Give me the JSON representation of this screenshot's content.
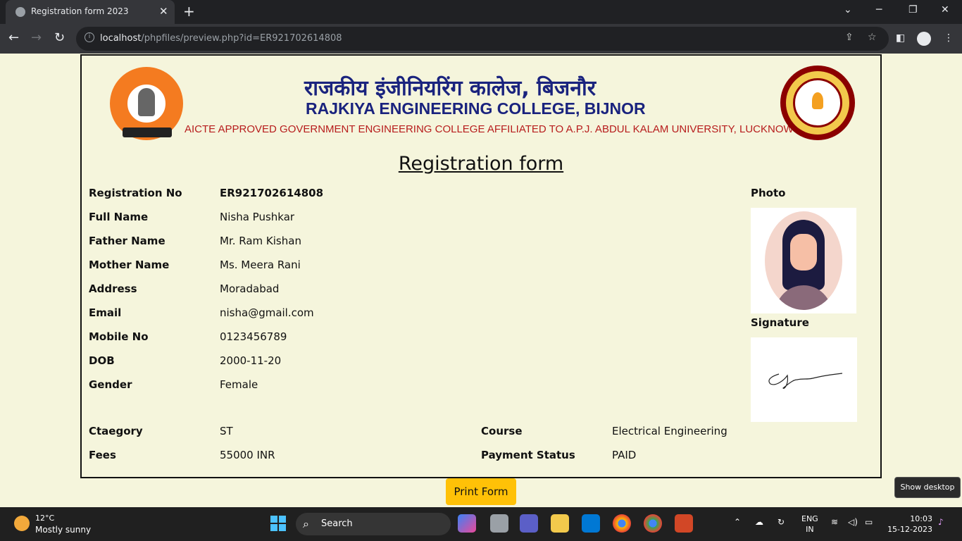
{
  "browser": {
    "tab_title": "Registration form 2023",
    "url_host": "localhost",
    "url_path": "/phpfiles/preview.php?id=ER921702614808"
  },
  "header": {
    "hindi_title": "राजकीय इंजीनियरिंग कालेज, बिजनौर",
    "english_title": "RAJKIYA ENGINEERING COLLEGE, BIJNOR",
    "subtitle": "AICTE APPROVED GOVERNMENT ENGINEERING COLLEGE AFFILIATED TO A.P.J. ABDUL KALAM UNIVERSITY, LUCKNOW (U.P.)"
  },
  "form": {
    "title": "Registration form",
    "fields": [
      {
        "label": "Registration No",
        "value": "ER921702614808"
      },
      {
        "label": "Full Name",
        "value": "Nisha Pushkar"
      },
      {
        "label": "Father Name",
        "value": "Mr. Ram Kishan"
      },
      {
        "label": "Mother Name",
        "value": "Ms. Meera Rani"
      },
      {
        "label": "Address",
        "value": "Moradabad"
      },
      {
        "label": "Email",
        "value": "nisha@gmail.com"
      },
      {
        "label": "Mobile No",
        "value": "0123456789"
      },
      {
        "label": "DOB",
        "value": "2000-11-20"
      },
      {
        "label": "Gender",
        "value": "Female"
      }
    ],
    "category": {
      "label": "Ctaegory",
      "value": "ST"
    },
    "fees": {
      "label": "Fees",
      "value": "55000 INR"
    },
    "course": {
      "label": "Course",
      "value": "Electrical Engineering"
    },
    "payment": {
      "label": "Payment Status",
      "value": "PAID"
    },
    "photo_label": "Photo",
    "signature_label": "Signature"
  },
  "print_button": "Print Form",
  "show_desktop": "Show desktop",
  "taskbar": {
    "temperature": "12°C",
    "condition": "Mostly sunny",
    "search_placeholder": "Search",
    "lang_line1": "ENG",
    "lang_line2": "IN",
    "time": "10:03",
    "date": "15-12-2023"
  }
}
